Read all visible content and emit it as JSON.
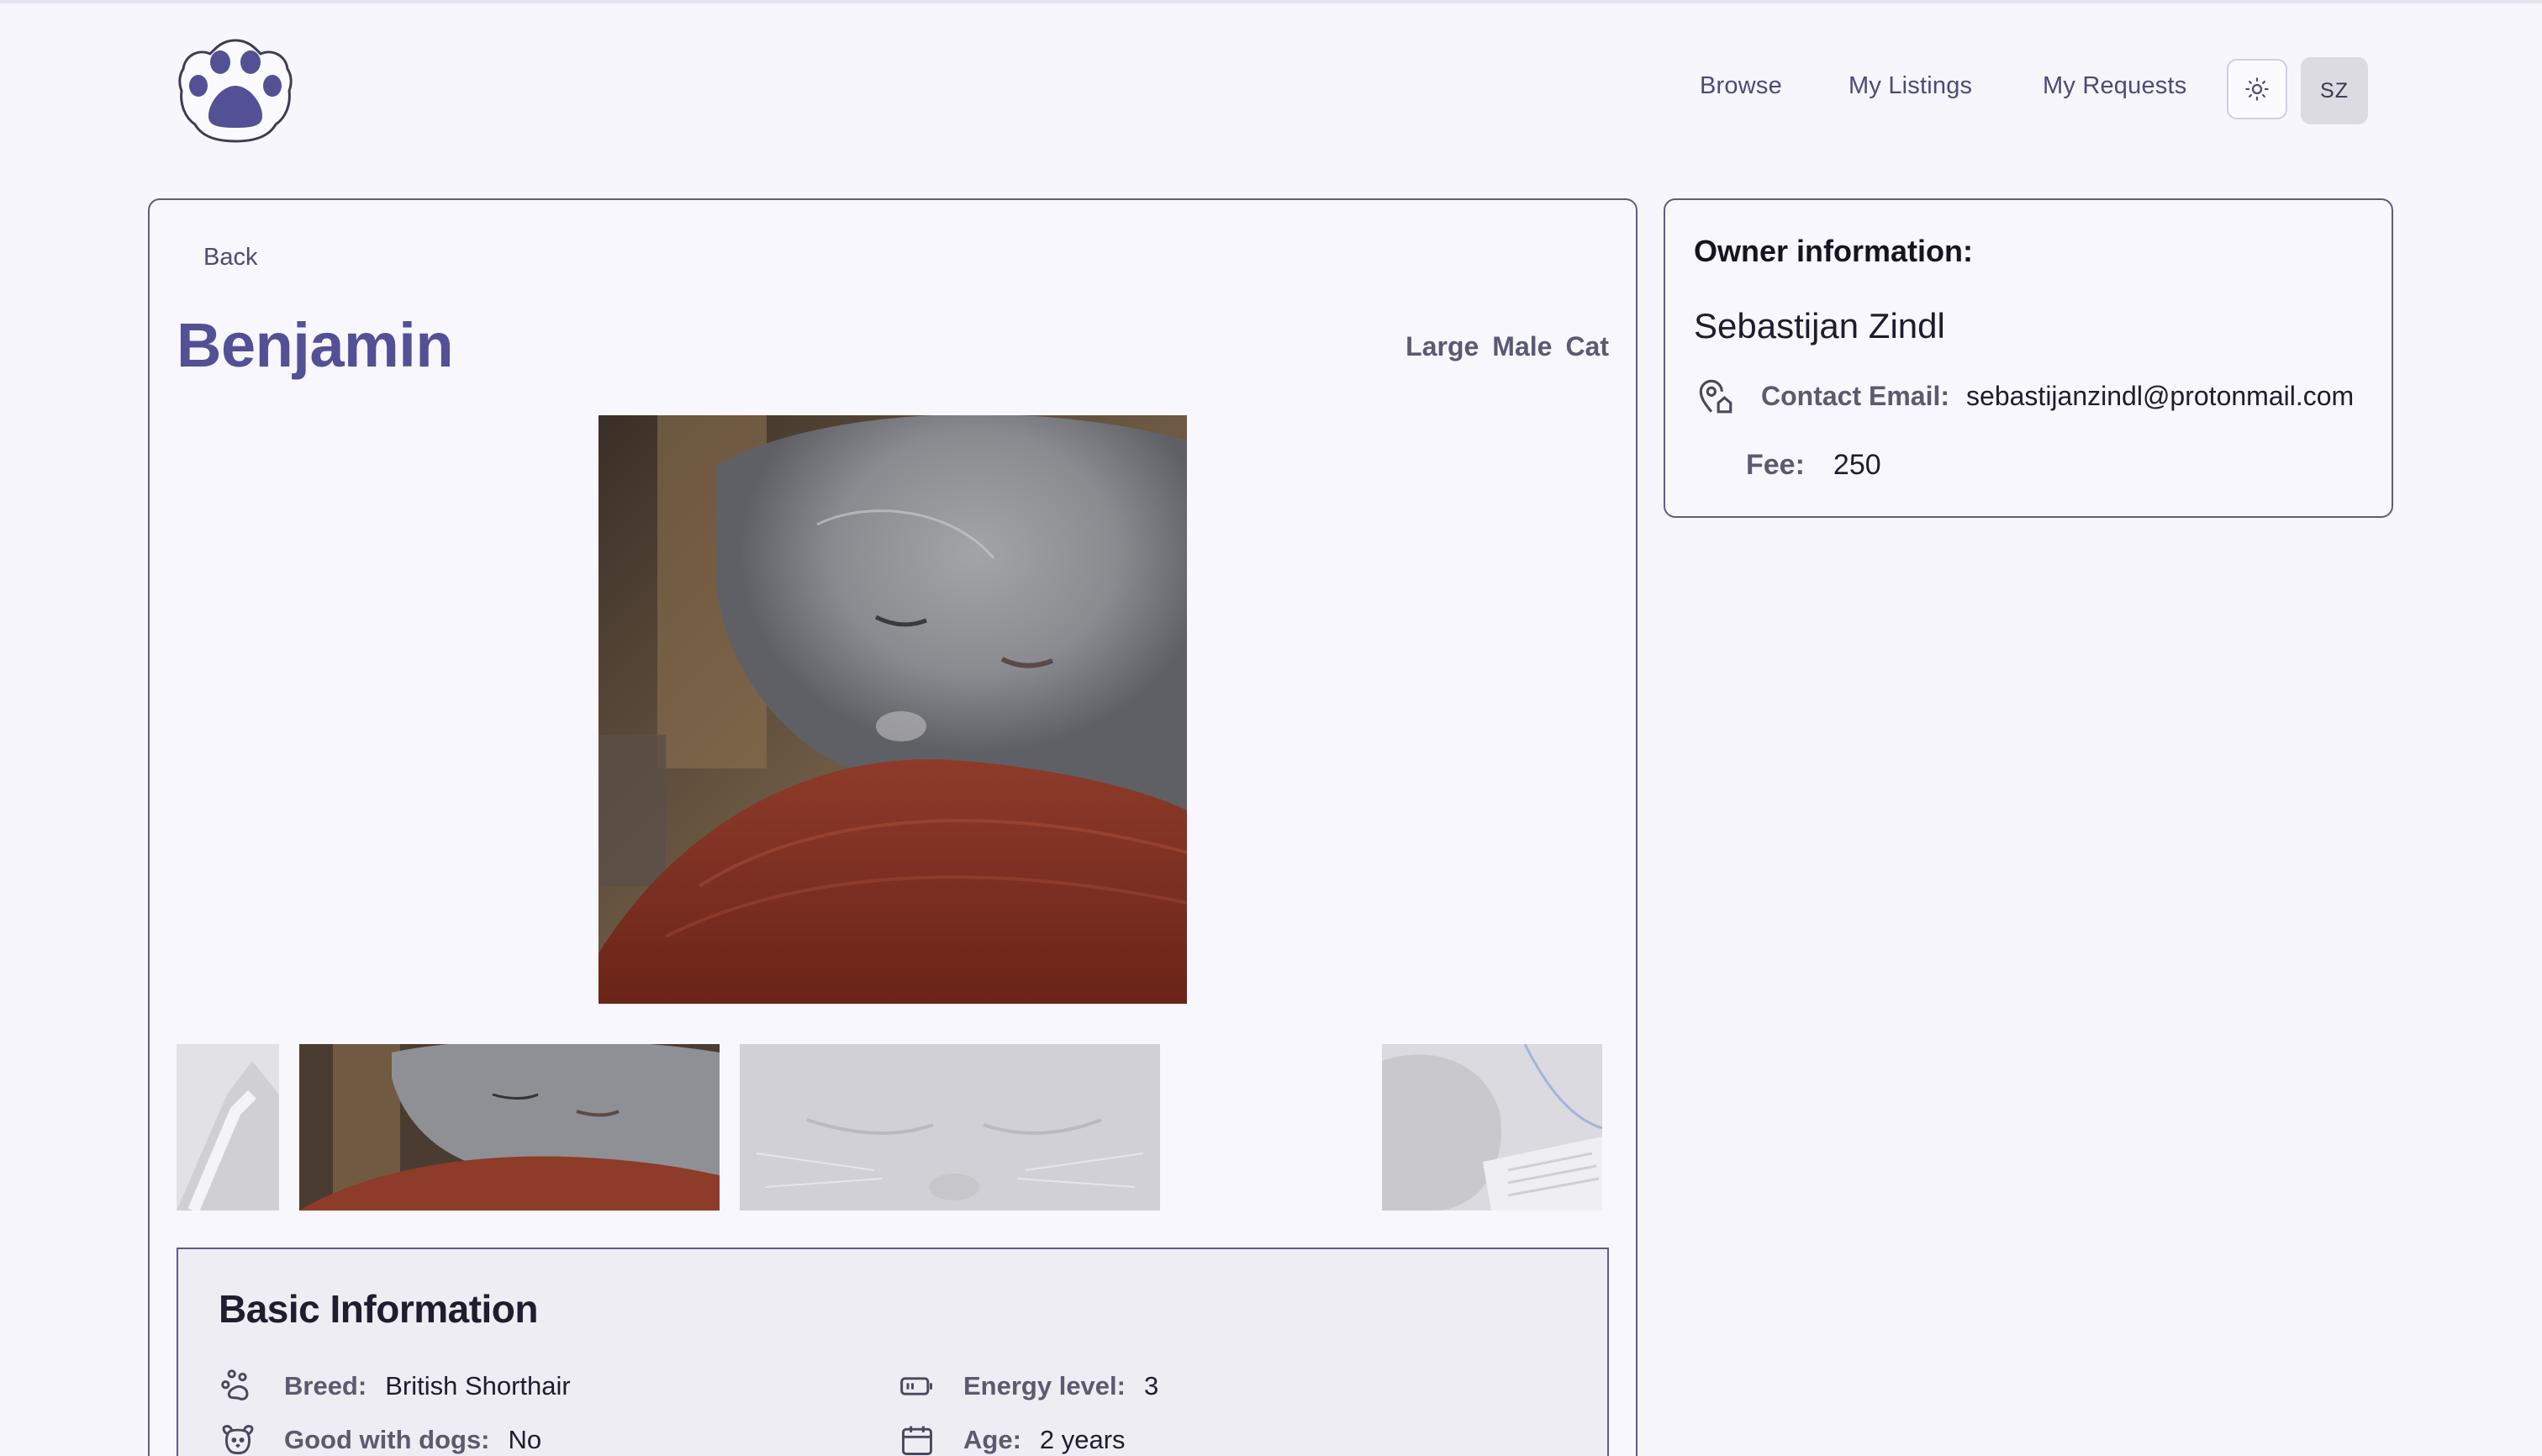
{
  "nav": {
    "browse": "Browse",
    "my_listings": "My Listings",
    "my_requests": "My Requests",
    "avatar_initials": "SZ",
    "theme_icon": "sun-icon",
    "logo_icon": "paw-icon"
  },
  "pet": {
    "back": "Back",
    "name": "Benjamin",
    "tags": [
      "Large",
      "Male",
      "Cat"
    ],
    "photo_count": 4,
    "active_photo": 2
  },
  "basic_info": {
    "title": "Basic Information",
    "breed_label": "Breed:",
    "breed_value": "British Shorthair",
    "dogs_label": "Good with dogs:",
    "dogs_value": "No",
    "energy_label": "Energy level:",
    "energy_value": "3",
    "age_label": "Age:",
    "age_value": "2 years"
  },
  "owner": {
    "title": "Owner information:",
    "name": "Sebastijan Zindl",
    "email_label": "Contact Email:",
    "email_value": "sebastijanzindl@protonmail.com",
    "fee_label": "Fee:",
    "fee_value": "250"
  },
  "colors": {
    "accent": "#535096",
    "background": "#f7f6fd",
    "border": "#5f5c82",
    "panel": "#eeedf3"
  }
}
